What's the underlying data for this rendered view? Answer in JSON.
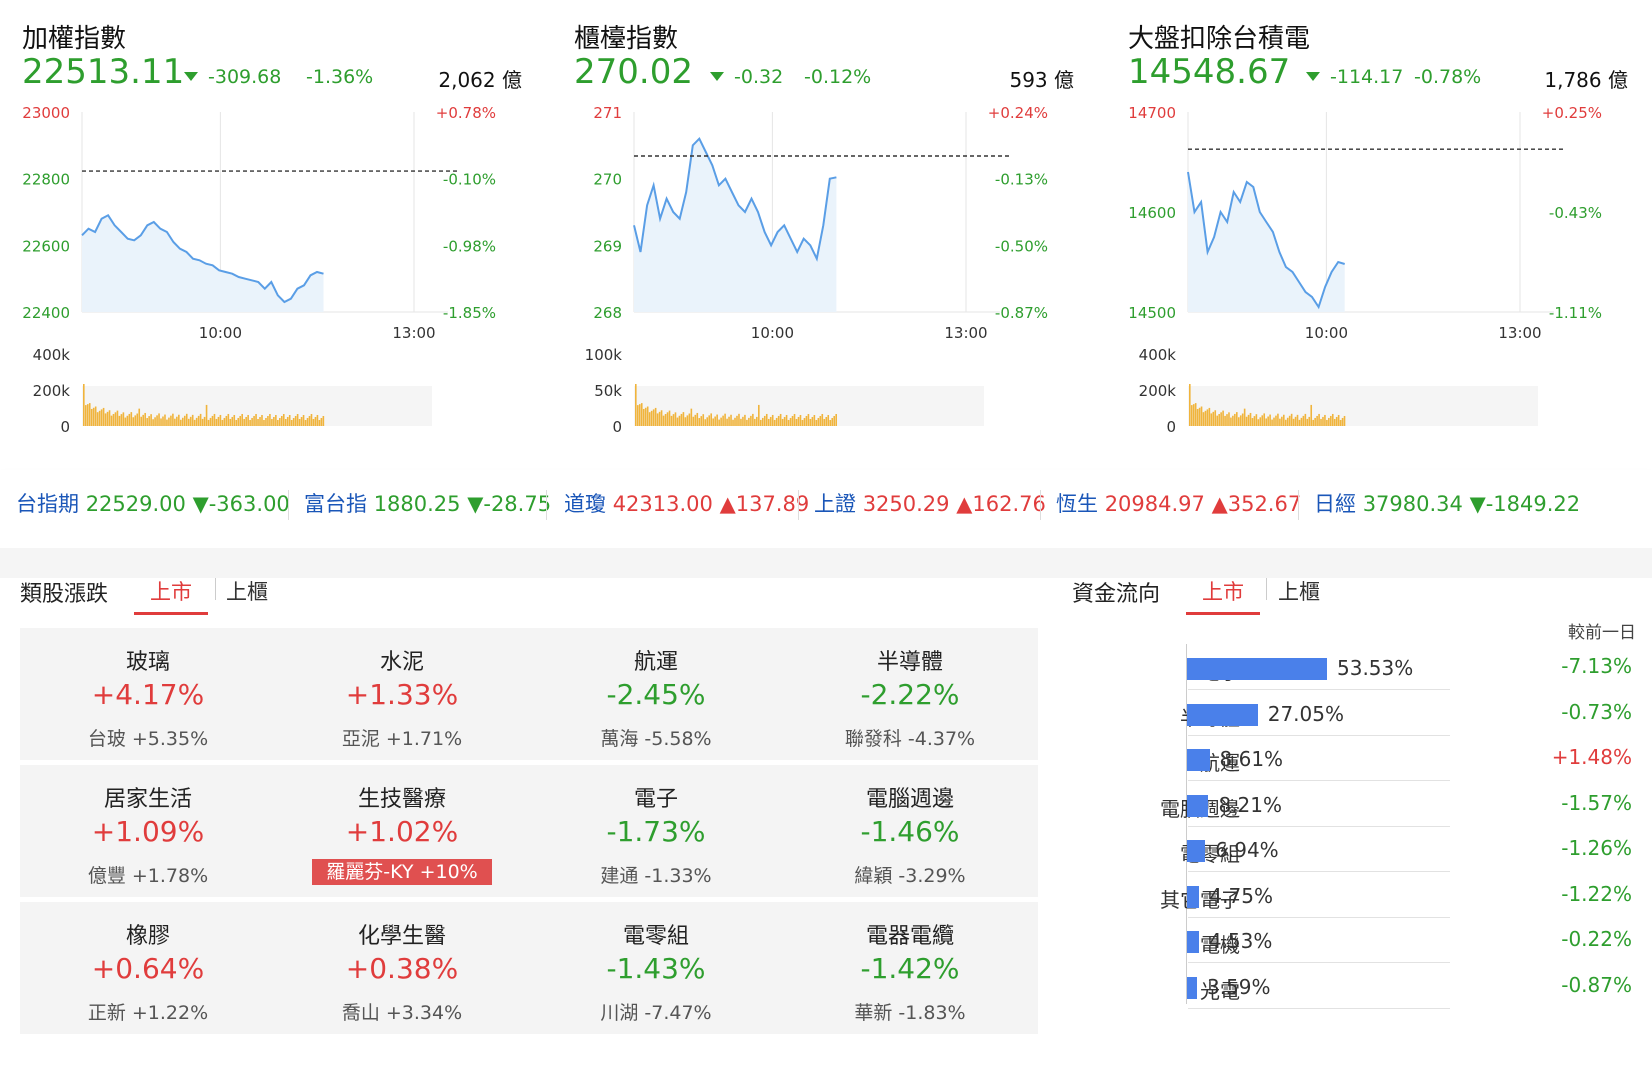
{
  "panels": [
    {
      "title": "加權指數",
      "price": "22513.11",
      "change": "-309.68",
      "pct": "-1.36%",
      "volume": "2,062 億",
      "y_labels": [
        "23000",
        "22800",
        "22600",
        "22400"
      ],
      "r_labels": [
        "+0.78%",
        "-0.10%",
        "-0.98%",
        "-1.85%"
      ],
      "x_labels": [
        "10:00",
        "13:00"
      ],
      "vol_labels": [
        "400k",
        "200k",
        "0"
      ]
    },
    {
      "title": "櫃檯指數",
      "price": "270.02",
      "change": "-0.32",
      "pct": "-0.12%",
      "volume": "593 億",
      "y_labels": [
        "271",
        "270",
        "269",
        "268"
      ],
      "r_labels": [
        "+0.24%",
        "-0.13%",
        "-0.50%",
        "-0.87%"
      ],
      "x_labels": [
        "10:00",
        "13:00"
      ],
      "vol_labels": [
        "100k",
        "50k",
        "0"
      ]
    },
    {
      "title": "大盤扣除台積電",
      "price": "14548.67",
      "change": "-114.17",
      "pct": "-0.78%",
      "volume": "1,786 億",
      "y_labels": [
        "14700",
        "14600",
        "14500"
      ],
      "r_labels": [
        "+0.25%",
        "-0.43%",
        "-1.11%"
      ],
      "x_labels": [
        "10:00",
        "13:00"
      ],
      "vol_labels": [
        "400k",
        "200k",
        "0"
      ]
    }
  ],
  "chart_data": [
    {
      "type": "line",
      "title": "加權指數",
      "ylim": [
        22400,
        23000
      ],
      "prev_close": 22822.79,
      "values": [
        22630,
        22650,
        22640,
        22680,
        22690,
        22660,
        22640,
        22620,
        22615,
        22630,
        22660,
        22670,
        22650,
        22640,
        22610,
        22590,
        22580,
        22560,
        22555,
        22545,
        22540,
        22525,
        22520,
        22515,
        22505,
        22500,
        22495,
        22490,
        22470,
        22490,
        22450,
        22430,
        22440,
        22470,
        22480,
        22510,
        22520,
        22515
      ]
    },
    {
      "type": "line",
      "title": "櫃檯指數",
      "ylim": [
        268,
        271
      ],
      "prev_close": 270.34,
      "values": [
        269.3,
        268.9,
        269.6,
        269.9,
        269.4,
        269.7,
        269.5,
        269.4,
        269.8,
        270.5,
        270.6,
        270.4,
        270.2,
        269.9,
        270.0,
        269.8,
        269.6,
        269.5,
        269.7,
        269.5,
        269.2,
        269.0,
        269.2,
        269.3,
        269.1,
        268.9,
        269.1,
        269.0,
        268.8,
        269.3,
        270.0,
        270.02
      ]
    },
    {
      "type": "line",
      "title": "大盤扣除台積電",
      "ylim": [
        14500,
        14700
      ],
      "prev_close": 14662.84,
      "values": [
        14640,
        14600,
        14610,
        14560,
        14575,
        14600,
        14590,
        14620,
        14610,
        14630,
        14625,
        14600,
        14590,
        14580,
        14560,
        14545,
        14540,
        14530,
        14520,
        14515,
        14505,
        14525,
        14540,
        14550,
        14548
      ]
    }
  ],
  "ticker": [
    {
      "name": "台指期",
      "value": "22529.00",
      "change": "▼-363.00",
      "dir": "down"
    },
    {
      "name": "富台指",
      "value": "1880.25",
      "change": "▼-28.75",
      "dir": "down"
    },
    {
      "name": "道瓊",
      "value": "42313.00",
      "change": "▲137.89",
      "dir": "up"
    },
    {
      "name": "上證",
      "value": "3250.29",
      "change": "▲162.76",
      "dir": "up"
    },
    {
      "name": "恆生",
      "value": "20984.97",
      "change": "▲352.67",
      "dir": "up"
    },
    {
      "name": "日經",
      "value": "37980.34",
      "change": "▼-1849.22",
      "dir": "down"
    }
  ],
  "sectors": {
    "title": "類股漲跌",
    "tabs": [
      "上市",
      "上櫃"
    ],
    "cards": [
      {
        "name": "玻璃",
        "pct": "+4.17%",
        "stock": "台玻 +5.35%",
        "dir": "up"
      },
      {
        "name": "水泥",
        "pct": "+1.33%",
        "stock": "亞泥 +1.71%",
        "dir": "up"
      },
      {
        "name": "航運",
        "pct": "-2.45%",
        "stock": "萬海 -5.58%",
        "dir": "down"
      },
      {
        "name": "半導體",
        "pct": "-2.22%",
        "stock": "聯發科 -4.37%",
        "dir": "down"
      },
      {
        "name": "居家生活",
        "pct": "+1.09%",
        "stock": "億豐 +1.78%",
        "dir": "up"
      },
      {
        "name": "生技醫療",
        "pct": "+1.02%",
        "stock": "羅麗芬-KY +10%",
        "dir": "up",
        "highlight": true
      },
      {
        "name": "電子",
        "pct": "-1.73%",
        "stock": "建通 -1.33%",
        "dir": "down"
      },
      {
        "name": "電腦週邊",
        "pct": "-1.46%",
        "stock": "緯穎 -3.29%",
        "dir": "down"
      },
      {
        "name": "橡膠",
        "pct": "+0.64%",
        "stock": "正新 +1.22%",
        "dir": "up"
      },
      {
        "name": "化學生醫",
        "pct": "+0.38%",
        "stock": "喬山 +3.34%",
        "dir": "up"
      },
      {
        "name": "電零組",
        "pct": "-1.43%",
        "stock": "川湖 -7.47%",
        "dir": "down"
      },
      {
        "name": "電器電纜",
        "pct": "-1.42%",
        "stock": "華新 -1.83%",
        "dir": "down"
      }
    ]
  },
  "fund_flow": {
    "title": "資金流向",
    "tabs": [
      "上市",
      "上櫃"
    ],
    "compare_label": "較前一日",
    "rows": [
      {
        "name": "電子",
        "pct": "53.53%",
        "share": 53.53,
        "chg": "-7.13%",
        "dir": "down"
      },
      {
        "name": "半導體",
        "pct": "27.05%",
        "share": 27.05,
        "chg": "-0.73%",
        "dir": "down"
      },
      {
        "name": "航運",
        "pct": "8.61%",
        "share": 8.61,
        "chg": "+1.48%",
        "dir": "up"
      },
      {
        "name": "電腦週邊",
        "pct": "8.21%",
        "share": 8.21,
        "chg": "-1.57%",
        "dir": "down"
      },
      {
        "name": "電零組",
        "pct": "6.94%",
        "share": 6.94,
        "chg": "-1.26%",
        "dir": "down"
      },
      {
        "name": "其它電子",
        "pct": "4.75%",
        "share": 4.75,
        "chg": "-1.22%",
        "dir": "down"
      },
      {
        "name": "電機",
        "pct": "4.53%",
        "share": 4.53,
        "chg": "-0.22%",
        "dir": "down"
      },
      {
        "name": "光電",
        "pct": "3.59%",
        "share": 3.59,
        "chg": "-0.87%",
        "dir": "down"
      }
    ]
  },
  "colors": {
    "up": "#e03c3c",
    "down": "#2e9e2e",
    "line": "#5a9ee6",
    "fill": "#eaf3fb",
    "vol": "#f0b43c",
    "bar": "#4a80ea"
  }
}
